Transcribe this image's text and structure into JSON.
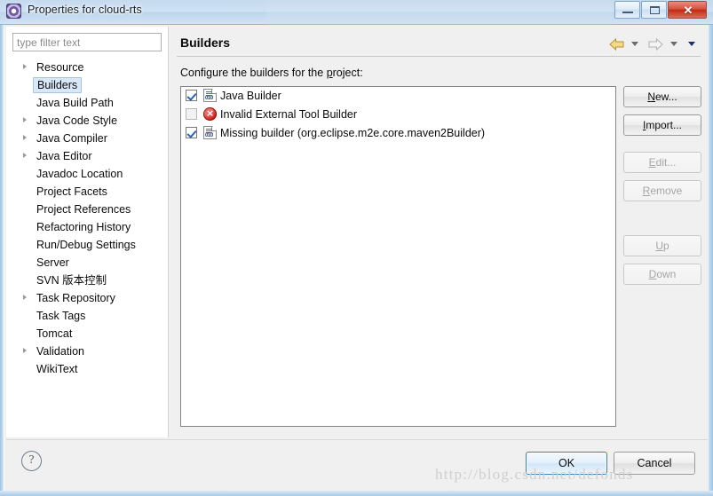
{
  "window": {
    "title": "Properties for cloud-rts",
    "app_icon": "eclipse-gear-icon",
    "buttons": {
      "minimize": "minimize-icon",
      "maximize": "maximize-icon",
      "close": "✕"
    }
  },
  "sidebar": {
    "filter": {
      "placeholder": "type filter text",
      "value": ""
    },
    "items": [
      {
        "label": "Resource",
        "expandable": true,
        "selected": false
      },
      {
        "label": "Builders",
        "expandable": false,
        "selected": true
      },
      {
        "label": "Java Build Path",
        "expandable": false,
        "selected": false
      },
      {
        "label": "Java Code Style",
        "expandable": true,
        "selected": false
      },
      {
        "label": "Java Compiler",
        "expandable": true,
        "selected": false
      },
      {
        "label": "Java Editor",
        "expandable": true,
        "selected": false
      },
      {
        "label": "Javadoc Location",
        "expandable": false,
        "selected": false
      },
      {
        "label": "Project Facets",
        "expandable": false,
        "selected": false
      },
      {
        "label": "Project References",
        "expandable": false,
        "selected": false
      },
      {
        "label": "Refactoring History",
        "expandable": false,
        "selected": false
      },
      {
        "label": "Run/Debug Settings",
        "expandable": false,
        "selected": false
      },
      {
        "label": "Server",
        "expandable": false,
        "selected": false
      },
      {
        "label": "SVN 版本控制",
        "expandable": false,
        "selected": false
      },
      {
        "label": "Task Repository",
        "expandable": true,
        "selected": false
      },
      {
        "label": "Task Tags",
        "expandable": false,
        "selected": false
      },
      {
        "label": "Tomcat",
        "expandable": false,
        "selected": false
      },
      {
        "label": "Validation",
        "expandable": true,
        "selected": false
      },
      {
        "label": "WikiText",
        "expandable": false,
        "selected": false
      }
    ]
  },
  "main": {
    "title": "Builders",
    "description_prefix": "Configure the builders for the ",
    "description_mnemonic": "p",
    "description_suffix": "roject:",
    "nav": {
      "back_icon": "back-arrow-icon",
      "back_enabled": true,
      "forward_icon": "forward-arrow-icon",
      "forward_enabled": false,
      "menu_icon": "chevron-down-icon"
    },
    "builders": [
      {
        "label": "Java Builder",
        "checked": true,
        "icon": "builder-icon"
      },
      {
        "label": "Invalid External Tool Builder",
        "checked": false,
        "icon": "error-icon"
      },
      {
        "label": "Missing builder (org.eclipse.m2e.core.maven2Builder)",
        "checked": true,
        "icon": "builder-icon"
      }
    ],
    "side_buttons": [
      {
        "prefix": "",
        "mnemonic": "N",
        "suffix": "ew...",
        "enabled": true
      },
      {
        "prefix": "",
        "mnemonic": "I",
        "suffix": "mport...",
        "enabled": true
      },
      {
        "prefix": "",
        "mnemonic": "E",
        "suffix": "dit...",
        "enabled": false
      },
      {
        "prefix": "",
        "mnemonic": "R",
        "suffix": "emove",
        "enabled": false
      },
      {
        "prefix": "",
        "mnemonic": "U",
        "suffix": "p",
        "enabled": false
      },
      {
        "prefix": "",
        "mnemonic": "D",
        "suffix": "own",
        "enabled": false
      }
    ]
  },
  "footer": {
    "help_icon": "help-question-icon",
    "ok_label": "OK",
    "cancel_label": "Cancel"
  },
  "watermark": "http://blog.csdn.net/defonds",
  "colors": {
    "accent": "#3c7fb1",
    "title_blue": "#c6dae e",
    "error_red": "#cf2119",
    "checkbox_check": "#2a62b8",
    "selection": "#d8e8f8"
  }
}
